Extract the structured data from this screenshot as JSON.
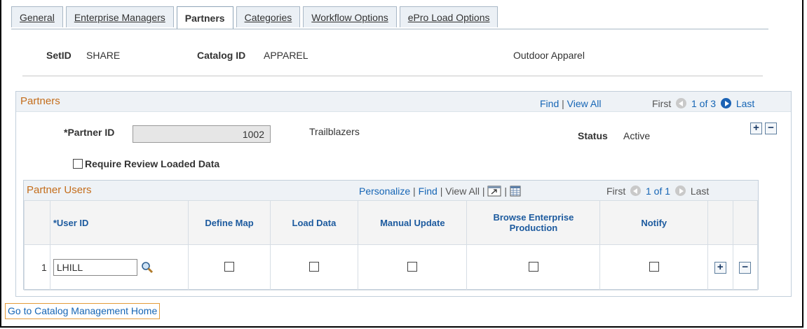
{
  "tabs": [
    {
      "label": "General",
      "active": false
    },
    {
      "label": "Enterprise Managers",
      "active": false
    },
    {
      "label": "Partners",
      "active": true
    },
    {
      "label": "Categories",
      "active": false
    },
    {
      "label": "Workflow Options",
      "active": false
    },
    {
      "label": "ePro Load Options",
      "active": false
    }
  ],
  "header": {
    "setid_label": "SetID",
    "setid_value": "SHARE",
    "catalog_label": "Catalog ID",
    "catalog_value": "APPAREL",
    "catalog_desc": "Outdoor Apparel"
  },
  "partners": {
    "title": "Partners",
    "find": "Find",
    "sep": "|",
    "view_all": "View All",
    "first": "First",
    "count": "1 of 3",
    "last": "Last",
    "partner_id_label": "*Partner ID",
    "partner_id_value": "1002",
    "partner_name": "Trailblazers",
    "status_label": "Status",
    "status_value": "Active",
    "require_review_label": "Require Review Loaded Data",
    "require_review_checked": false
  },
  "partner_users": {
    "title": "Partner Users",
    "personalize": "Personalize",
    "find": "Find",
    "view_all": "View All",
    "sep": "|",
    "first": "First",
    "count": "1 of 1",
    "last": "Last",
    "columns": [
      "*User ID",
      "Define Map",
      "Load Data",
      "Manual Update",
      "Browse Enterprise Production",
      "Notify"
    ],
    "rows": [
      {
        "num": "1",
        "user_id": "LHILL",
        "define_map": false,
        "load_data": false,
        "manual_update": false,
        "browse_enterprise": false,
        "notify": false
      }
    ]
  },
  "footer": {
    "go_home": "Go to Catalog Management Home"
  },
  "icons": {
    "add": "plus-icon",
    "remove": "minus-icon",
    "lookup": "magnifier-icon",
    "prev": "prev-arrow-icon",
    "next": "next-arrow-icon",
    "zoom": "zoom-window-icon",
    "download": "grid-download-icon"
  },
  "colors": {
    "group_title": "#c46d1b",
    "link": "#1565b5",
    "nav_active": "#1b62b4"
  }
}
